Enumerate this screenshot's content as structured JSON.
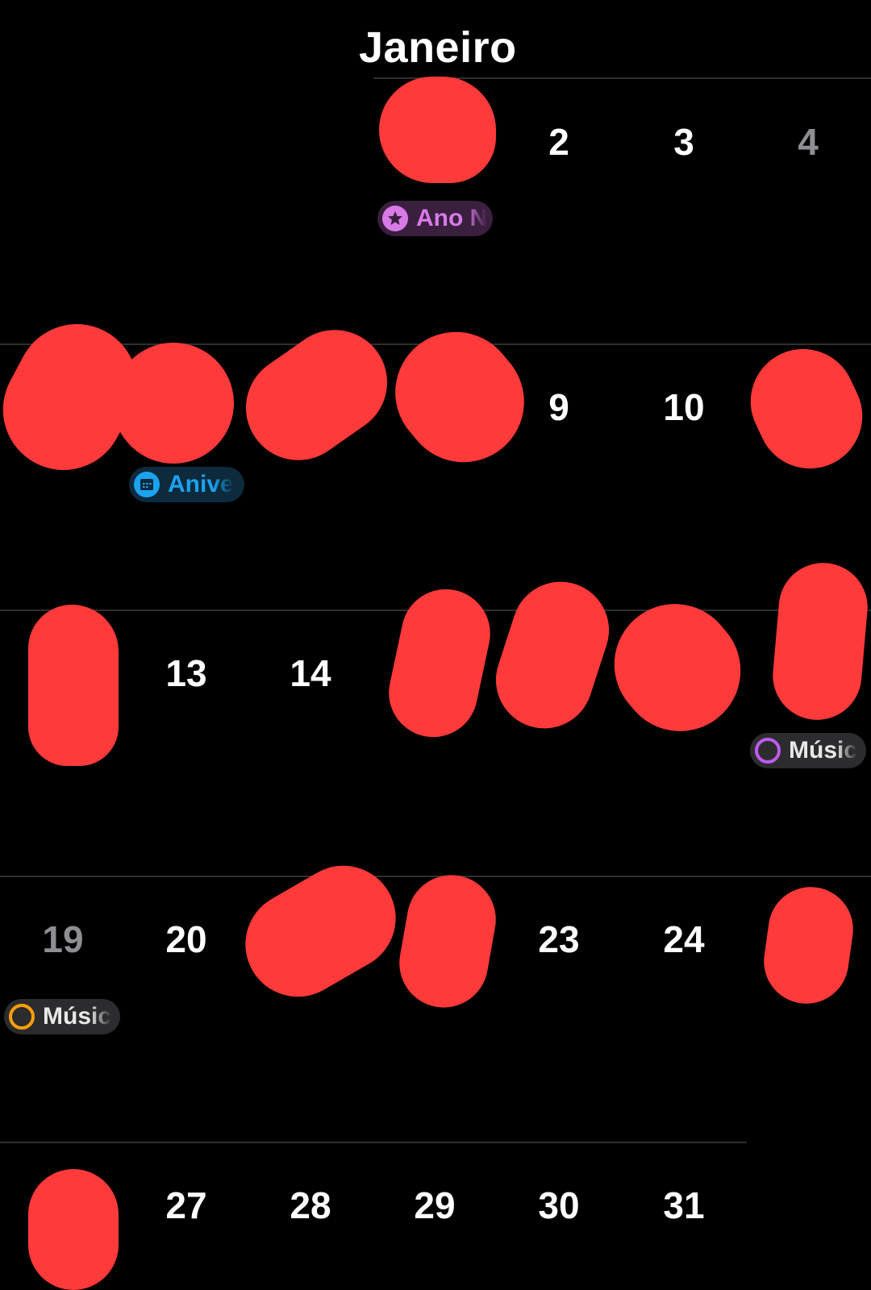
{
  "month": {
    "title": "Janeiro"
  },
  "colors": {
    "background": "#000000",
    "separator": "#2f2f2f",
    "weekend_day": "#8e8e93",
    "redaction": "#ff3a3a",
    "event_purple": "#d77ae6",
    "event_blue": "#1aa3ef",
    "ring_purple": "#bf5af2",
    "ring_orange": "#ff9f0a"
  },
  "days": {
    "d2": "2",
    "d3": "3",
    "d4": "4",
    "d9": "9",
    "d10": "10",
    "d13": "13",
    "d14": "14",
    "d19": "19",
    "d20": "20",
    "d23": "23",
    "d24": "24",
    "d27": "27",
    "d28": "28",
    "d29": "29",
    "d30": "30",
    "d31": "31"
  },
  "events": {
    "ano_novo": {
      "label": "Ano N",
      "icon": "star-icon"
    },
    "aniversario": {
      "label": "Anive",
      "icon": "calendar-icon"
    },
    "musica_1": {
      "label": "Músic",
      "icon": "ring-icon"
    },
    "musica_2": {
      "label": "Músic",
      "icon": "ring-icon"
    }
  }
}
